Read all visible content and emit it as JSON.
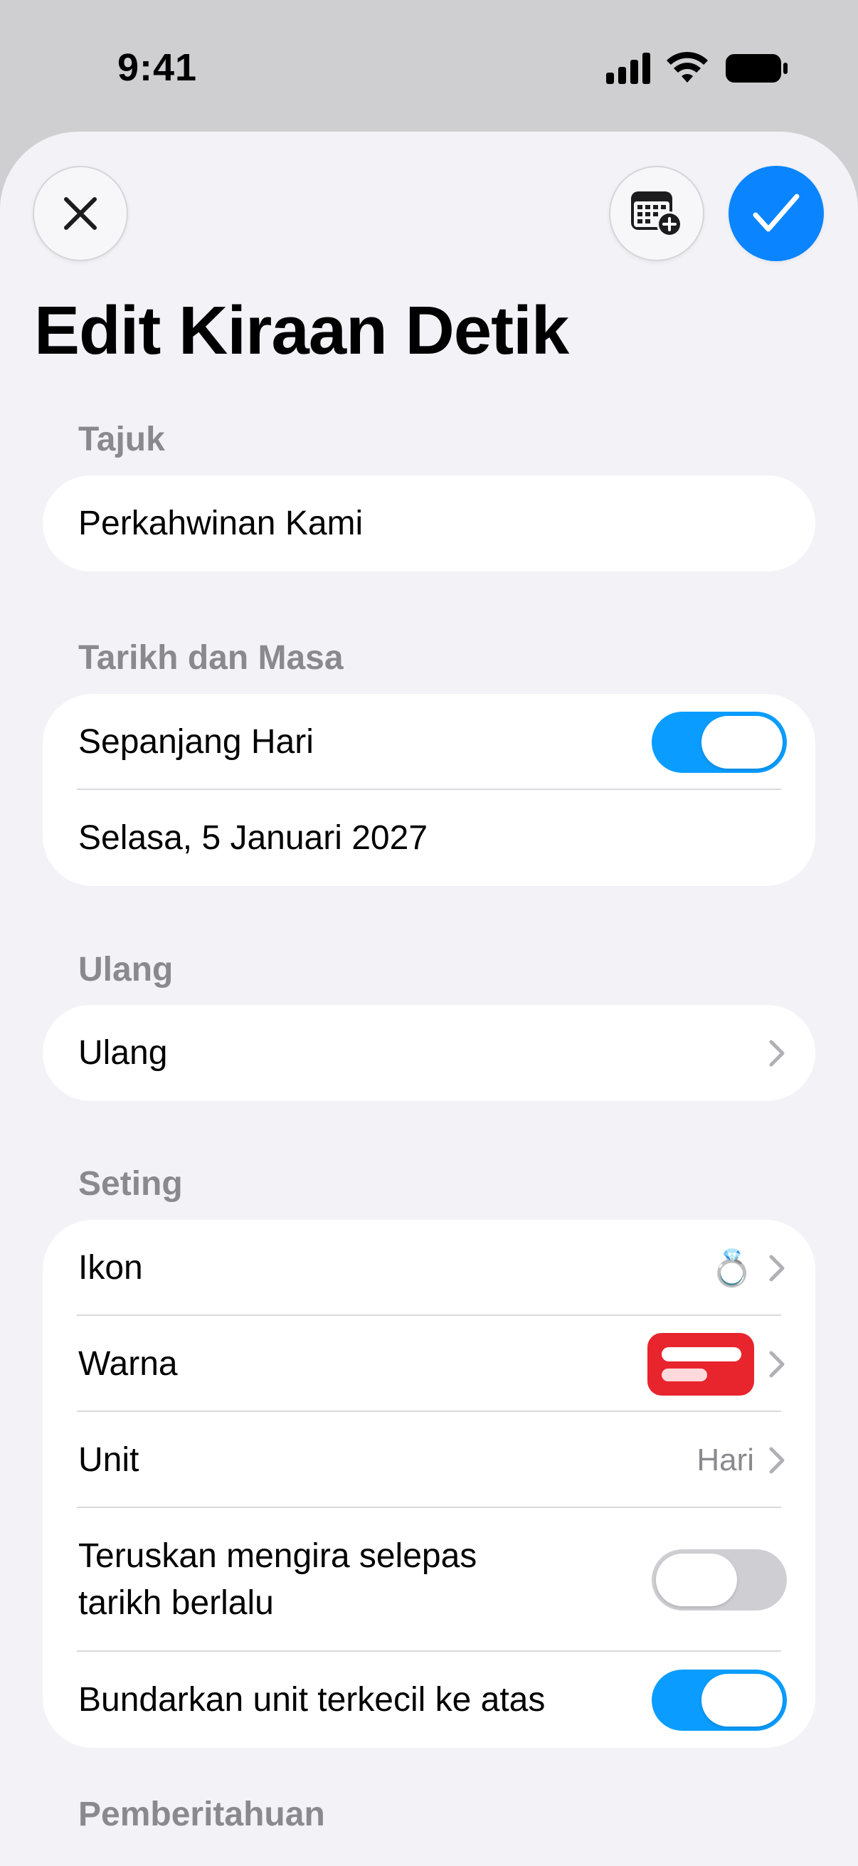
{
  "status_bar": {
    "time": "9:41"
  },
  "header": {
    "title": "Edit Kiraan Detik"
  },
  "sections": {
    "title": {
      "label": "Tajuk",
      "value": "Perkahwinan Kami"
    },
    "datetime": {
      "label": "Tarikh dan Masa",
      "all_day_label": "Sepanjang Hari",
      "all_day_on": true,
      "date_value": "Selasa, 5 Januari 2027"
    },
    "repeat": {
      "label": "Ulang",
      "row_label": "Ulang"
    },
    "settings": {
      "label": "Seting",
      "icon_label": "Ikon",
      "icon_value": "💍",
      "color_label": "Warna",
      "color_value": "#e8242c",
      "unit_label": "Unit",
      "unit_value": "Hari",
      "continue_label": "Teruskan mengira selepas tarikh berlalu",
      "continue_on": false,
      "round_label": "Bundarkan unit terkecil ke atas",
      "round_on": true
    },
    "notifications": {
      "label": "Pemberitahuan"
    }
  },
  "colors": {
    "accent": "#0a84ff",
    "toggle_on": "#0a9dff"
  }
}
